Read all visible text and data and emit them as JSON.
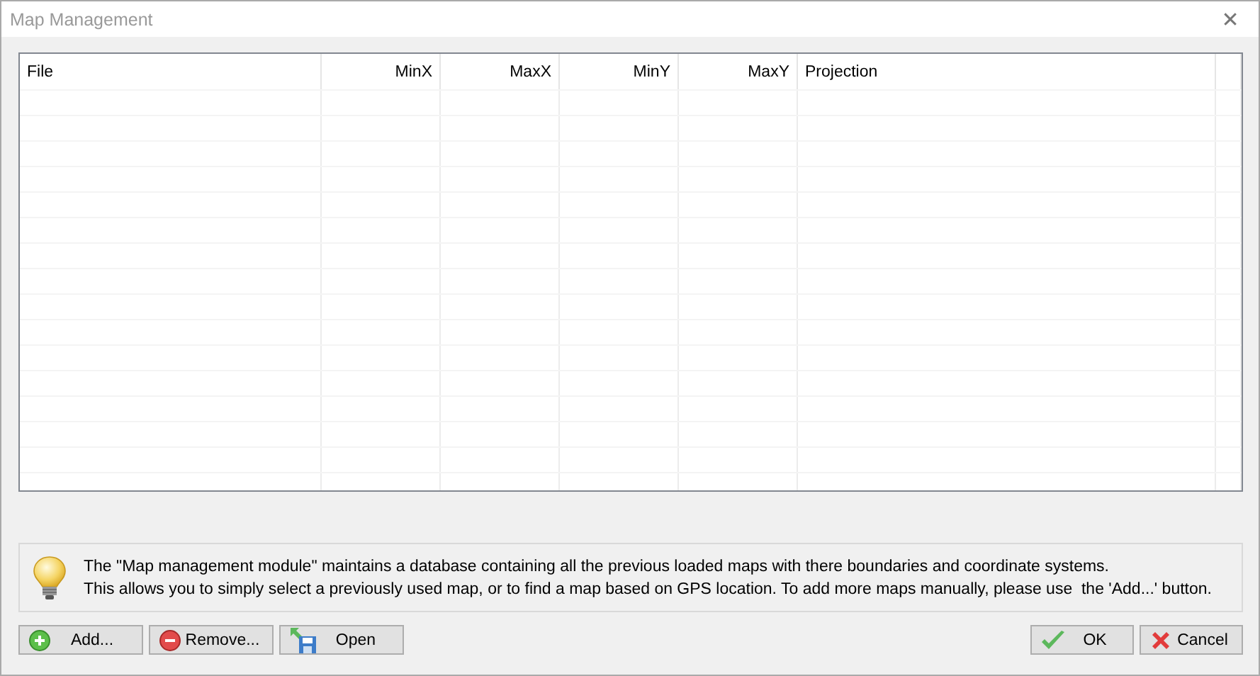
{
  "window": {
    "title": "Map Management",
    "close": "✕"
  },
  "table": {
    "columns": [
      {
        "label": "File",
        "kind": "text"
      },
      {
        "label": "MinX",
        "kind": "number"
      },
      {
        "label": "MaxX",
        "kind": "number"
      },
      {
        "label": "MinY",
        "kind": "number"
      },
      {
        "label": "MaxY",
        "kind": "number"
      },
      {
        "label": "Projection",
        "kind": "text"
      }
    ]
  },
  "info": {
    "lines": [
      "The \"Map management module\" maintains a database containing all the previous loaded maps with there boundaries and coordinate systems.",
      "This allows you to simply select a previously used map, or to find a map based on GPS location. To add more maps manually, please use  the 'Add...' button."
    ]
  },
  "buttons": [
    {
      "label": "Add...",
      "kind": "add"
    },
    {
      "label": "Remove...",
      "kind": "remove"
    },
    {
      "label": "Open",
      "kind": "open"
    }
  ],
  "dialog_buttons": [
    {
      "label": "OK",
      "kind": "ok"
    },
    {
      "label": "Cancel",
      "kind": "cancel"
    }
  ]
}
